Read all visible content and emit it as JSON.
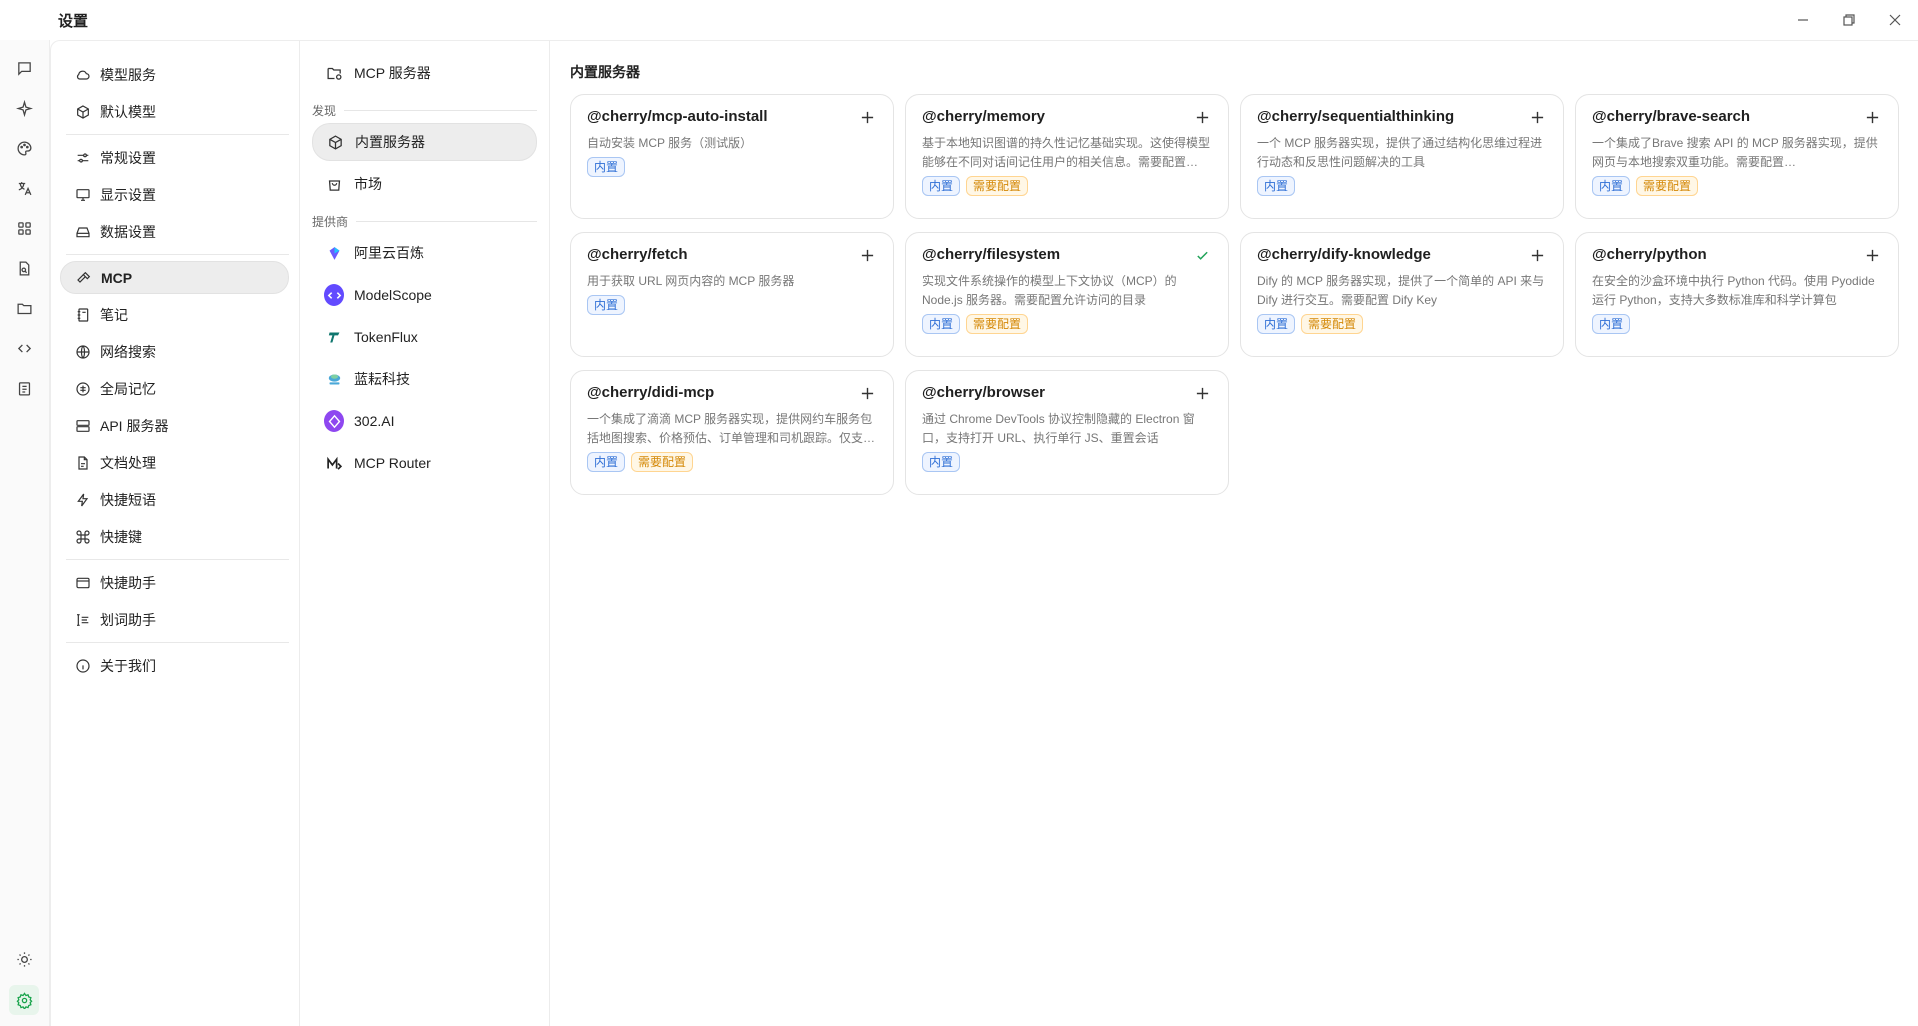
{
  "window": {
    "title": "设置"
  },
  "nav": {
    "items": [
      {
        "label": "模型服务",
        "icon": "cloud-icon"
      },
      {
        "label": "默认模型",
        "icon": "cube-icon"
      },
      {
        "label": "常规设置",
        "icon": "sliders-icon"
      },
      {
        "label": "显示设置",
        "icon": "monitor-icon"
      },
      {
        "label": "数据设置",
        "icon": "database-icon"
      },
      {
        "label": "MCP",
        "icon": "hammer-icon"
      },
      {
        "label": "笔记",
        "icon": "notebook-icon"
      },
      {
        "label": "网络搜索",
        "icon": "globe-icon"
      },
      {
        "label": "全局记忆",
        "icon": "brain-icon"
      },
      {
        "label": "API 服务器",
        "icon": "server-icon"
      },
      {
        "label": "文档处理",
        "icon": "file-icon"
      },
      {
        "label": "快捷短语",
        "icon": "zap-icon"
      },
      {
        "label": "快捷键",
        "icon": "command-icon"
      },
      {
        "label": "快捷助手",
        "icon": "app-window-icon"
      },
      {
        "label": "划词助手",
        "icon": "text-select-icon"
      },
      {
        "label": "关于我们",
        "icon": "info-icon"
      }
    ]
  },
  "subnav": {
    "top": {
      "label": "MCP 服务器"
    },
    "discover_label": "发现",
    "discover": [
      {
        "label": "内置服务器"
      },
      {
        "label": "市场"
      }
    ],
    "providers_label": "提供商",
    "providers": [
      {
        "label": "阿里云百炼",
        "color": "#6a5cff"
      },
      {
        "label": "ModelScope",
        "color": "#624aff"
      },
      {
        "label": "TokenFlux",
        "color": "#0f766e"
      },
      {
        "label": "蓝耘科技",
        "color": "#4aa8d8"
      },
      {
        "label": "302.AI",
        "color": "#8e47f0"
      },
      {
        "label": "MCP Router",
        "color": "#222222"
      }
    ]
  },
  "content": {
    "section_title": "内置服务器",
    "tag_builtin": "内置",
    "tag_config": "需要配置",
    "servers": [
      {
        "name": "@cherry/mcp-auto-install",
        "desc": "自动安装 MCP 服务（测试版）",
        "installed": false,
        "needs_config": false
      },
      {
        "name": "@cherry/memory",
        "desc": "基于本地知识图谱的持久性记忆基础实现。这使得模型能够在不同对话间记住用户的相关信息。需要配置 MEMORY_FILE_PATH 环境变量。",
        "installed": false,
        "needs_config": true
      },
      {
        "name": "@cherry/sequentialthinking",
        "desc": "一个 MCP 服务器实现，提供了通过结构化思维过程进行动态和反思性问题解决的工具",
        "installed": false,
        "needs_config": false
      },
      {
        "name": "@cherry/brave-search",
        "desc": "一个集成了Brave 搜索 API 的 MCP 服务器实现，提供网页与本地搜索双重功能。需要配置 BRAVE_API_KEY 环境变量",
        "installed": false,
        "needs_config": true
      },
      {
        "name": "@cherry/fetch",
        "desc": "用于获取 URL 网页内容的 MCP 服务器",
        "installed": false,
        "needs_config": false
      },
      {
        "name": "@cherry/filesystem",
        "desc": "实现文件系统操作的模型上下文协议（MCP）的 Node.js 服务器。需要配置允许访问的目录",
        "installed": true,
        "needs_config": true
      },
      {
        "name": "@cherry/dify-knowledge",
        "desc": "Dify 的 MCP 服务器实现，提供了一个简单的 API 来与 Dify 进行交互。需要配置 Dify Key",
        "installed": false,
        "needs_config": true
      },
      {
        "name": "@cherry/python",
        "desc": "在安全的沙盒环境中执行 Python 代码。使用 Pyodide 运行 Python，支持大多数标准库和科学计算包",
        "installed": false,
        "needs_config": false
      },
      {
        "name": "@cherry/didi-mcp",
        "desc": "一个集成了滴滴 MCP 服务器实现，提供网约车服务包括地图搜索、价格预估、订单管理和司机跟踪。仅支持中国大陆地区。需要配置 DIDI_API_KEY 环境变量",
        "installed": false,
        "needs_config": true
      },
      {
        "name": "@cherry/browser",
        "desc": "通过 Chrome DevTools 协议控制隐藏的 Electron 窗口，支持打开 URL、执行单行 JS、重置会话",
        "installed": false,
        "needs_config": false
      }
    ]
  }
}
